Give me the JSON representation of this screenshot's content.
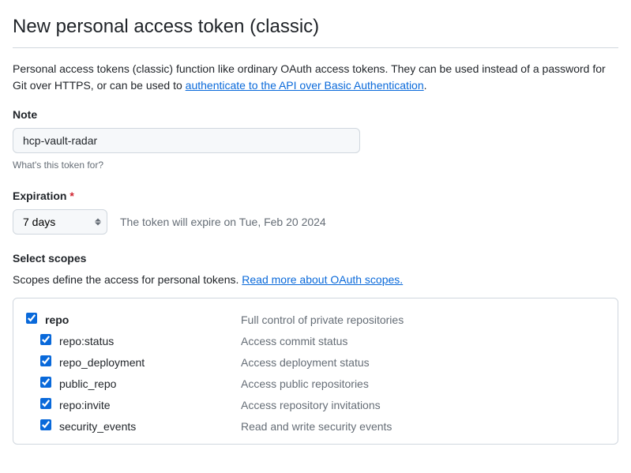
{
  "page_title": "New personal access token (classic)",
  "intro_text_1": "Personal access tokens (classic) function like ordinary OAuth access tokens. They can be used instead of a password for Git over HTTPS, or can be used to ",
  "intro_link": "authenticate to the API over Basic Authentication",
  "intro_text_2": ".",
  "note": {
    "label": "Note",
    "value": "hcp-vault-radar",
    "hint": "What's this token for?"
  },
  "expiration": {
    "label": "Expiration",
    "selected": "7 days",
    "hint": "The token will expire on Tue, Feb 20 2024"
  },
  "scopes": {
    "heading": "Select scopes",
    "intro_text": "Scopes define the access for personal tokens. ",
    "intro_link": "Read more about OAuth scopes.",
    "parent": {
      "name": "repo",
      "desc": "Full control of private repositories"
    },
    "children": [
      {
        "name": "repo:status",
        "desc": "Access commit status"
      },
      {
        "name": "repo_deployment",
        "desc": "Access deployment status"
      },
      {
        "name": "public_repo",
        "desc": "Access public repositories"
      },
      {
        "name": "repo:invite",
        "desc": "Access repository invitations"
      },
      {
        "name": "security_events",
        "desc": "Read and write security events"
      }
    ]
  }
}
